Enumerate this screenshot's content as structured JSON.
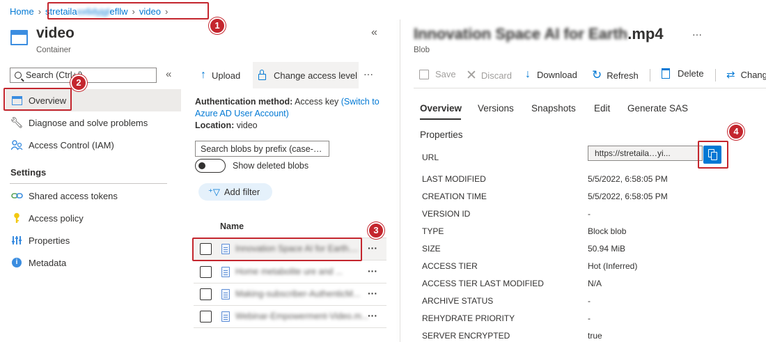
{
  "breadcrumb": {
    "home": "Home",
    "account": "stretaila…efllw",
    "container": "video"
  },
  "container": {
    "title": "video",
    "subtitle": "Container",
    "collapse": "«"
  },
  "sidebar": {
    "search_placeholder": "Search (Ctrl+/)",
    "collapse": "«",
    "items": [
      {
        "label": "Overview",
        "icon": "container-icon"
      },
      {
        "label": "Diagnose and solve problems",
        "icon": "wrench-icon"
      },
      {
        "label": "Access Control (IAM)",
        "icon": "people-icon"
      }
    ],
    "settings_heading": "Settings",
    "settings_items": [
      {
        "label": "Shared access tokens",
        "icon": "link-icon"
      },
      {
        "label": "Access policy",
        "icon": "key-icon"
      },
      {
        "label": "Properties",
        "icon": "bars-icon"
      },
      {
        "label": "Metadata",
        "icon": "info-icon"
      }
    ]
  },
  "middle": {
    "upload": "Upload",
    "change_access": "Change access level",
    "more": "···",
    "auth_label": "Authentication method:",
    "auth_value": "Access key",
    "switch_link_1": "(Switch to",
    "switch_link_2": "Azure AD User Account)",
    "location_label": "Location:",
    "location_value": "video",
    "search_blobs_placeholder": "Search blobs by prefix (case-…",
    "show_deleted": "Show deleted blobs",
    "add_filter": "Add filter",
    "name_header": "Name",
    "blobs": [
      "Innovation Space AI for Earth....",
      "Home metabolite ure and ...",
      "Making-subscriber-AuthenticM...",
      "Webinar-Empowerment-Video.m..."
    ],
    "row_more": "···"
  },
  "blob": {
    "title_blurred": "Innovation Space AI for Earth",
    "title_ext": ".mp4",
    "title_more": "···",
    "subtitle": "Blob",
    "toolbar": {
      "save": "Save",
      "discard": "Discard",
      "download": "Download",
      "refresh": "Refresh",
      "delete": "Delete",
      "change": "Chang"
    },
    "tabs": [
      "Overview",
      "Versions",
      "Snapshots",
      "Edit",
      "Generate SAS"
    ],
    "properties_heading": "Properties",
    "url_label": "URL",
    "url_value": "https://stretaila…yi...",
    "props": [
      {
        "label": "LAST MODIFIED",
        "value": "5/5/2022, 6:58:05 PM"
      },
      {
        "label": "CREATION TIME",
        "value": "5/5/2022, 6:58:05 PM"
      },
      {
        "label": "VERSION ID",
        "value": "-"
      },
      {
        "label": "TYPE",
        "value": "Block blob"
      },
      {
        "label": "SIZE",
        "value": "50.94 MiB"
      },
      {
        "label": "ACCESS TIER",
        "value": "Hot (Inferred)"
      },
      {
        "label": "ACCESS TIER LAST MODIFIED",
        "value": "N/A"
      },
      {
        "label": "ARCHIVE STATUS",
        "value": "-"
      },
      {
        "label": "REHYDRATE PRIORITY",
        "value": "-"
      },
      {
        "label": "SERVER ENCRYPTED",
        "value": "true"
      }
    ]
  },
  "callouts": [
    "1",
    "2",
    "3",
    "4"
  ],
  "colors": {
    "accent": "#0078d4",
    "callout": "#c4262e"
  }
}
